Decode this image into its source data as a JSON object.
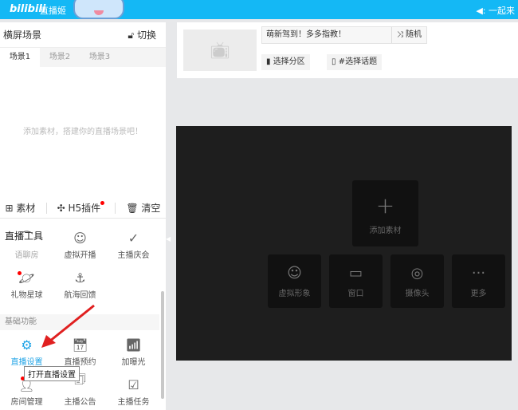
{
  "topbar": {
    "logo": "bilibili",
    "title": "直播姬",
    "right": "◀: 一起来"
  },
  "left": {
    "title": "横屏场景",
    "switch": "切换",
    "tabs": [
      "场景1",
      "场景2",
      "场景3"
    ],
    "empty": "添加素材，搭建你的直播场景吧！",
    "toolbar": {
      "material": "素材",
      "h5": "H5插件",
      "clear": "清空"
    },
    "tools_title": "直播工具",
    "tools": [
      {
        "label": "语聊房",
        "icon": "arch-icon"
      },
      {
        "label": "虚拟开播",
        "icon": "avatar-icon"
      },
      {
        "label": "主播庆会",
        "icon": "party-icon"
      },
      {
        "label": "礼物星球",
        "icon": "planet-icon"
      },
      {
        "label": "航海回馈",
        "icon": "anchor-icon"
      }
    ],
    "basic_title": "基础功能",
    "basic": [
      {
        "label": "直播设置",
        "icon": "gear-icon"
      },
      {
        "label": "直播预约",
        "icon": "calendar-icon"
      },
      {
        "label": "加曝光",
        "icon": "bar-chart-icon"
      },
      {
        "label": "房间管理",
        "icon": "user-gear-icon"
      },
      {
        "label": "主播公告",
        "icon": "announcement-icon"
      },
      {
        "label": "主播任务",
        "icon": "task-icon"
      }
    ],
    "tooltip": "打开直播设置"
  },
  "card": {
    "title": "萌新驾到！多多指教！",
    "random": "随机",
    "area": "选择分区",
    "topic": "#选择话题"
  },
  "preview": {
    "add": "添加素材",
    "tiles": [
      "虚拟形象",
      "窗口",
      "摄像头",
      "更多"
    ]
  },
  "colors": {
    "accent": "#14b8f5",
    "active": "#1fa3e6"
  }
}
